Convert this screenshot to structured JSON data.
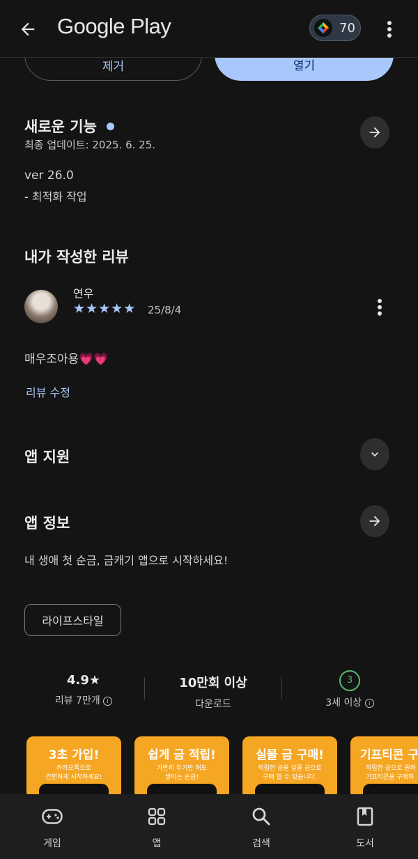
{
  "header": {
    "brand": "Google Play",
    "points": "70"
  },
  "actions": {
    "remove_label": "제거",
    "open_label": "열기"
  },
  "whats_new": {
    "title": "새로운 기능",
    "updated": "최종 업데이트: 2025. 6. 25.",
    "version": "ver 26.0",
    "note": "- 최적화 작업"
  },
  "my_review": {
    "section_title": "내가 작성한 리뷰",
    "author": "연우",
    "rating": 5,
    "date": "25/8/4",
    "text": "매우조아용💗💗",
    "edit_label": "리뷰 수정"
  },
  "app_support": {
    "title": "앱 지원"
  },
  "app_info": {
    "title": "앱 정보",
    "description": "내 생애 첫 순금, 금캐기 앱으로 시작하세요!",
    "category": "라이프스타일"
  },
  "stats": {
    "rating": "4.9★",
    "reviews": "리뷰 7만개",
    "downloads": "10만회 이상",
    "downloads_label": "다운로드",
    "age_badge": "3",
    "age_label": "3세 이상"
  },
  "screenshots": [
    {
      "title": "3초 가입!",
      "sub": "카카오톡으로\n간편하게 시작하세요!"
    },
    {
      "title": "쉽게 금 적립!",
      "sub": "가만히 두기만 해도\n쌓이는 순금!"
    },
    {
      "title": "실물 금 구매!",
      "sub": "적립한 금을 실물 금으로\n구매 할 수 있습니다."
    },
    {
      "title": "기프티콘 구",
      "sub": "적립한 금으로 원하\n기프티콘을 구매하"
    }
  ],
  "bottom_nav": [
    {
      "label": "게임",
      "icon": "gamepad-icon"
    },
    {
      "label": "앱",
      "icon": "apps-grid-icon"
    },
    {
      "label": "검색",
      "icon": "search-icon"
    },
    {
      "label": "도서",
      "icon": "book-icon"
    }
  ],
  "colors": {
    "background": "#141414",
    "accent": "#a8c7fa",
    "screenshot_bg": "#f5a623",
    "age_badge": "#5bb974"
  }
}
